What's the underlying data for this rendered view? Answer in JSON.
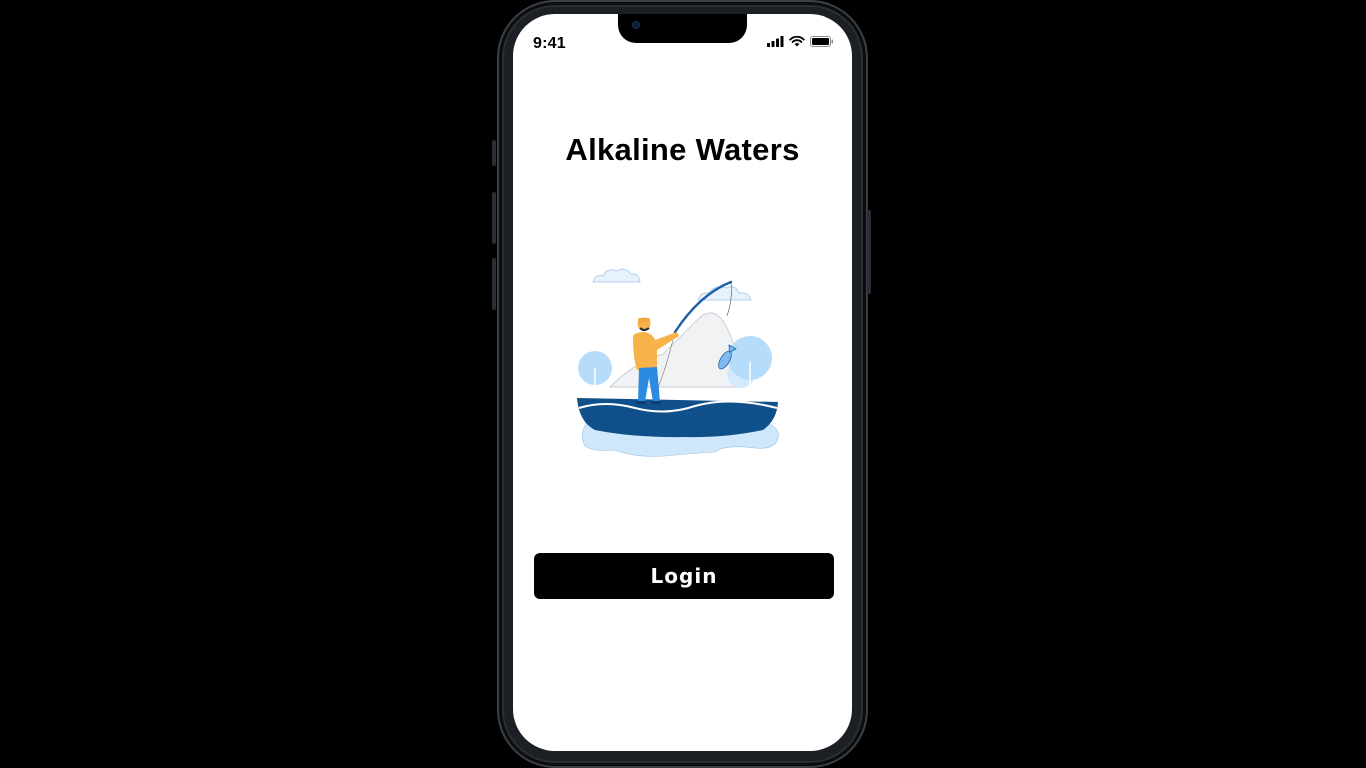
{
  "status_bar": {
    "time": "9:41",
    "icons": [
      "signal-icon",
      "wifi-icon",
      "battery-icon"
    ]
  },
  "app": {
    "title": "Alkaline Waters"
  },
  "illustration": {
    "subject": "fishing-boat-illustration"
  },
  "actions": {
    "login_label": "Login"
  },
  "colors": {
    "background": "#000000",
    "screen": "#ffffff",
    "button": "#000000",
    "button_text": "#ffffff",
    "boat": "#0f4f8a",
    "water": "#cfe7fb"
  }
}
